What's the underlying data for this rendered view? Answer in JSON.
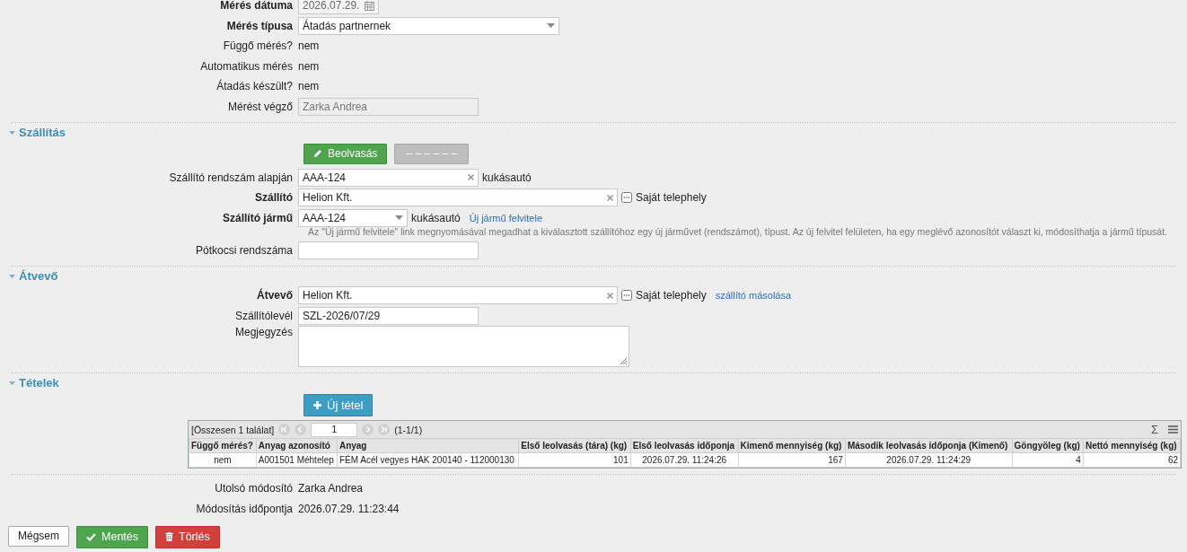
{
  "measurement": {
    "fields": [
      {
        "kind": "date",
        "label": "Mérés dátuma",
        "required": true,
        "value": "2026.07.29."
      },
      {
        "kind": "select",
        "label": "Mérés típusa",
        "required": true,
        "value": "Átadás partnernek"
      },
      {
        "kind": "text",
        "label": "Függő mérés?",
        "required": false,
        "value": "nem"
      },
      {
        "kind": "text",
        "label": "Automatikus mérés",
        "required": false,
        "value": "nem"
      },
      {
        "kind": "text",
        "label": "Átadás készült?",
        "required": false,
        "value": "nem"
      },
      {
        "kind": "readonly",
        "label": "Mérést végző",
        "required": false,
        "value": "Zarka Andrea"
      }
    ]
  },
  "sections": [
    {
      "title": "Szállítás",
      "expanded": true,
      "buttons": [
        {
          "kind": "primary",
          "label": "Beolvasás",
          "disabled": false
        },
        {
          "kind": "plain",
          "label": "– – – – – –",
          "disabled": true
        }
      ],
      "fields": [
        {
          "kind": "search",
          "label": "Szállító rendszám alapján",
          "required": false,
          "value": "AAA-124",
          "suffix": "kukásautó"
        },
        {
          "kind": "lookup",
          "label": "Szállító",
          "required": true,
          "value": "Helion Kft.",
          "suffix": "Saját telephely"
        },
        {
          "kind": "dropdown",
          "label": "Szállító jármű",
          "required": true,
          "value": "AAA-124",
          "suffix": "kukásautó",
          "link": "Új jármű felvitele",
          "hint": "Az \"Új jármű felvitele\" link megnyomásával megadhat a kiválasztott szállítóhoz egy új járművet (rendszámot), típust. Az új felvitel felületen, ha egy meglévő azonosítót választ ki, módosíthatja a jármű típusát."
        },
        {
          "kind": "input",
          "label": "Pótkocsi rendszáma",
          "required": false
        }
      ]
    },
    {
      "title": "Átvevő",
      "expanded": true,
      "fields": [
        {
          "kind": "lookup",
          "label": "Átvevő",
          "required": true,
          "value": "Helion Kft.",
          "suffix": "Saját telephely",
          "link": "szállító másolása"
        },
        {
          "kind": "input",
          "label": "Szállítólevél",
          "required": false,
          "value": "SZL-2026/07/29"
        },
        {
          "kind": "textarea",
          "label": "Megjegyzés",
          "required": false
        }
      ]
    },
    {
      "title": "Tételek",
      "expanded": true,
      "buttons": [
        {
          "kind": "add",
          "label": "Új tétel",
          "disabled": false
        }
      ],
      "grid": {
        "summary": "[Összesen 1 találat]",
        "page": "1",
        "range": "(1-1/1)",
        "sum": "Σ",
        "columns": [
          {
            "title": "Függő mérés?",
            "kind": "flag"
          },
          {
            "title": "Anyag azonosító",
            "kind": "text"
          },
          {
            "title": "Anyag",
            "kind": "text"
          },
          {
            "title": "Első leolvasás (tára) (kg)",
            "kind": "number"
          },
          {
            "title": "Első leolvasás időponja",
            "kind": "date"
          },
          {
            "title": "Kimenő mennyiség (kg)",
            "kind": "number"
          },
          {
            "title": "Második leolvasás időponja (Kimenő)",
            "kind": "date"
          },
          {
            "title": "Göngyöleg (kg)",
            "kind": "number"
          },
          {
            "title": "Nettó mennyiség (kg)",
            "kind": "number"
          }
        ],
        "rows": [
          [
            "nem",
            "A001501 Méhtelep",
            "FÉM Acél vegyes HAK 200140 - 112000130",
            "101",
            "2026.07.29. 11:24:26",
            "167",
            "2026.07.29. 11:24:29",
            "4",
            "62"
          ]
        ]
      }
    }
  ],
  "footer": {
    "fields": [
      {
        "kind": "text",
        "label": "Utolsó módosító",
        "required": false,
        "value": "Zarka Andrea"
      },
      {
        "kind": "text",
        "label": "Módosítás időpontja",
        "required": false,
        "value": "2026.07.29. 11:23:44"
      }
    ]
  },
  "actions": [
    {
      "kind": "plain",
      "label": "Mégsem"
    },
    {
      "kind": "save",
      "label": "Mentés"
    },
    {
      "kind": "delete",
      "label": "Törlés"
    }
  ]
}
